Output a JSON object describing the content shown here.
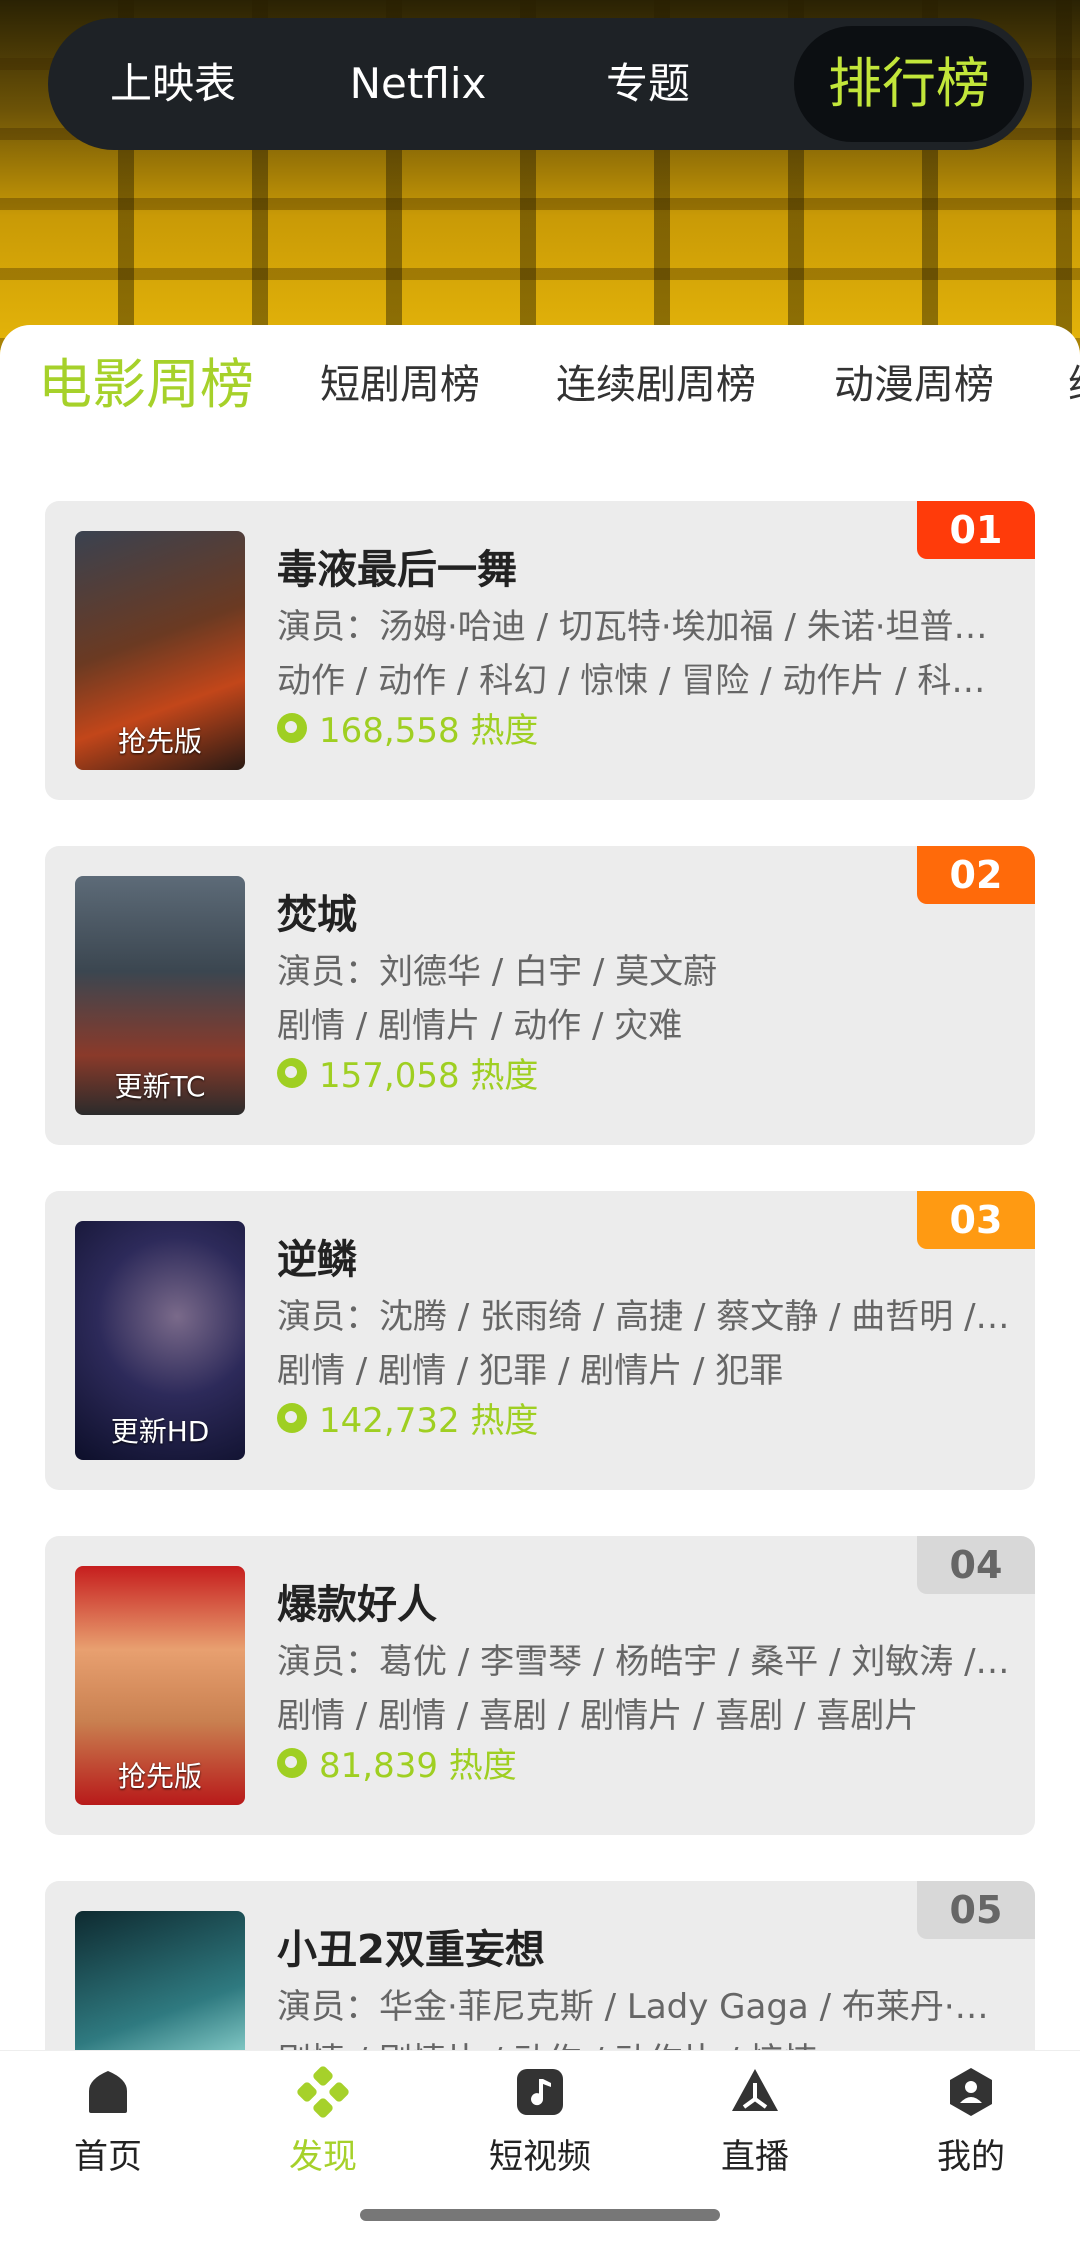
{
  "top_tabs": [
    {
      "label": "上映表"
    },
    {
      "label": "Netflix"
    },
    {
      "label": "专题"
    },
    {
      "label": "排行榜",
      "active": true
    }
  ],
  "sub_tabs": [
    {
      "label": "电影周榜",
      "active": true
    },
    {
      "label": "短剧周榜"
    },
    {
      "label": "连续剧周榜"
    },
    {
      "label": "动漫周榜"
    },
    {
      "label": "综"
    }
  ],
  "items": [
    {
      "rank": "01",
      "rank_color": "#ff3b0a",
      "title": "毒液最后一舞",
      "cast": "演员：汤姆·哈迪 / 切瓦特·埃加福 / 朱诺·坦普…",
      "genres": "动作 / 动作 / 科幻 / 惊悚 / 冒险 / 动作片 / 科…",
      "heat": "168,558 热度",
      "badge": "抢先版"
    },
    {
      "rank": "02",
      "rank_color": "#ff6a0a",
      "title": "焚城",
      "cast": "演员：刘德华 / 白宇 / 莫文蔚",
      "genres": "剧情 / 剧情片 / 动作 / 灾难",
      "heat": "157,058 热度",
      "badge": "更新TC"
    },
    {
      "rank": "03",
      "rank_color": "#ff9a12",
      "title": "逆鳞",
      "cast": "演员：沈腾 / 张雨绮 / 高捷 / 蔡文静 / 曲哲明 /…",
      "genres": "剧情 / 剧情 / 犯罪 / 剧情片 / 犯罪",
      "heat": "142,732 热度",
      "badge": "更新HD"
    },
    {
      "rank": "04",
      "rank_color": "#d8d8d8",
      "title": "爆款好人",
      "cast": "演员：葛优 / 李雪琴 / 杨皓宇 / 桑平 / 刘敏涛 /…",
      "genres": "剧情 / 剧情 / 喜剧 / 剧情片 / 喜剧 / 喜剧片",
      "heat": "81,839 热度",
      "badge": "抢先版"
    },
    {
      "rank": "05",
      "rank_color": "#d8d8d8",
      "title": "小丑2双重妄想",
      "cast": "演员：华金·菲尼克斯 / Lady Gaga / 布莱丹·格…",
      "genres": "剧情 / 剧情片 / 动作 / 动作片 / 惊悚",
      "heat": "",
      "badge": ""
    }
  ],
  "bottom_nav": [
    {
      "label": "首页",
      "icon": "home-icon"
    },
    {
      "label": "发现",
      "icon": "discover-icon",
      "active": true
    },
    {
      "label": "短视频",
      "icon": "music-note-icon"
    },
    {
      "label": "直播",
      "icon": "live-icon"
    },
    {
      "label": "我的",
      "icon": "profile-icon"
    }
  ],
  "colors": {
    "accent": "#a6d12a",
    "nav_bg": "#1e2226"
  }
}
